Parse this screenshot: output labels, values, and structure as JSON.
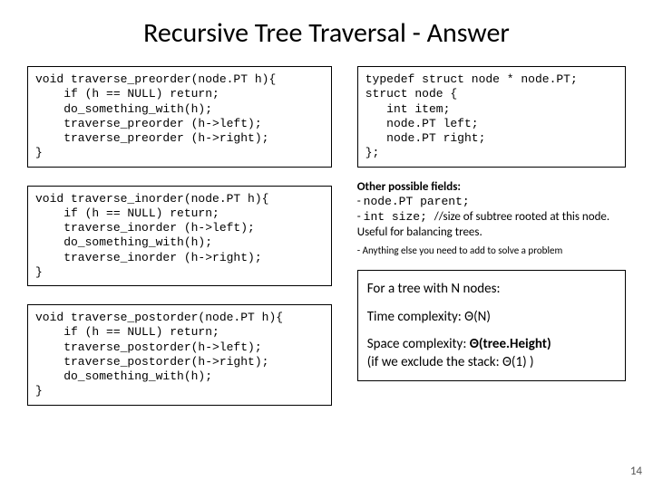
{
  "title": "Recursive Tree Traversal - Answer",
  "code": {
    "preorder": "void traverse_preorder(node.PT h){\n    if (h == NULL) return;\n    do_something_with(h);\n    traverse_preorder (h->left);\n    traverse_preorder (h->right);\n}",
    "inorder": "void traverse_inorder(node.PT h){\n    if (h == NULL) return;\n    traverse_inorder (h->left);\n    do_something_with(h);\n    traverse_inorder (h->right);\n}",
    "postorder": "void traverse_postorder(node.PT h){\n    if (h == NULL) return;\n    traverse_postorder(h->left);\n    traverse_postorder(h->right);\n    do_something_with(h);\n}",
    "typedef": "typedef struct node * node.PT;\nstruct node {\n   int item;\n   node.PT left;\n   node.PT right;\n};"
  },
  "fields": {
    "header": "Other possible fields:",
    "l1a": "- ",
    "l1b": "node.PT parent;",
    "l2a": "- ",
    "l2b": "int size; ",
    "l2c": "//size of subtree rooted at this node. Useful for balancing trees.",
    "l3a": "-   ",
    "l3b": "Anything  else you need to add to solve a problem"
  },
  "complexity": {
    "l1": "For a tree with N nodes:",
    "l2a": "Time complexity:  ",
    "l2b": "Θ(N)",
    "l3a": "Space complexity:  ",
    "l3b": "Θ(tree.Height)",
    "l4": "(if we exclude the stack: Θ(1)  )"
  },
  "pagenum": "14"
}
